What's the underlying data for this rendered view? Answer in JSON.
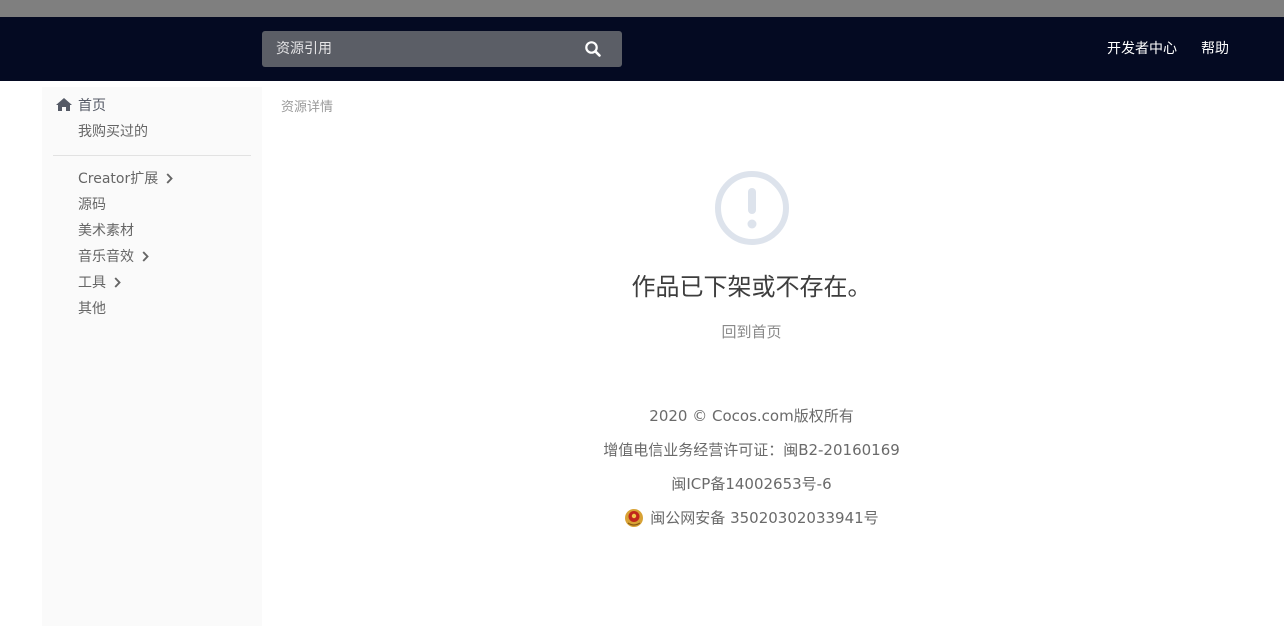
{
  "header": {
    "search": {
      "placeholder": "资源引用",
      "icon": "search-icon"
    },
    "nav": [
      {
        "label": "开发者中心"
      },
      {
        "label": "帮助"
      }
    ]
  },
  "sidebar": {
    "home": {
      "label": "首页",
      "icon": "home-icon"
    },
    "purchased": {
      "label": "我购买过的"
    },
    "categories": [
      {
        "label": "Creator扩展",
        "has_submenu": true
      },
      {
        "label": "源码",
        "has_submenu": false
      },
      {
        "label": "美术素材",
        "has_submenu": false
      },
      {
        "label": "音乐音效",
        "has_submenu": true
      },
      {
        "label": "工具",
        "has_submenu": true
      },
      {
        "label": "其他",
        "has_submenu": false
      }
    ]
  },
  "main": {
    "breadcrumb": "资源详情",
    "status_icon": "exclamation-circle-icon",
    "message": "作品已下架或不存在。",
    "back_home": "回到首页"
  },
  "footer": {
    "copyright": "2020 © Cocos.com版权所有",
    "license": "增值电信业务经营许可证：闽B2-20160169",
    "icp": "闽ICP备14002653号-6",
    "police_record": "闽公网安备 35020302033941号",
    "police_icon": "police-badge-icon"
  },
  "colors": {
    "navbar_bg": "#040a22",
    "search_bg": "#5b5e66",
    "sidebar_bg": "#fafafa",
    "icon_gray": "#dde3ec"
  }
}
